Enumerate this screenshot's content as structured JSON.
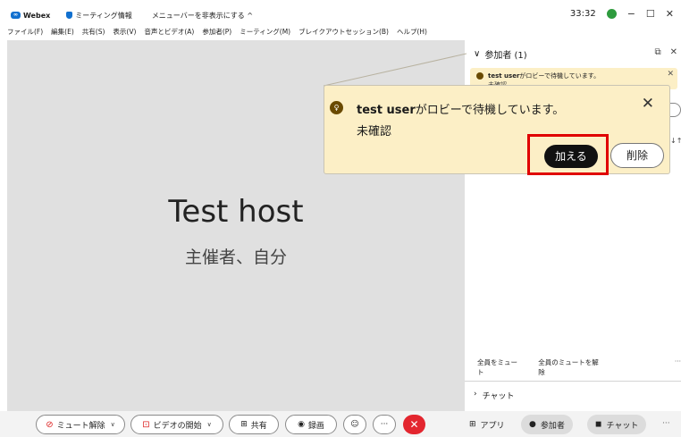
{
  "titlebar": {
    "app_name": "Webex",
    "meeting_info": "ミーティング情報",
    "hide_menu": "メニューバーを非表示にする",
    "hide_menu_chevron": "^",
    "timer": "33:32",
    "minimize": "−",
    "restore": "☐",
    "close": "✕"
  },
  "menubar": {
    "items": [
      "ファイル(F)",
      "編集(E)",
      "共有(S)",
      "表示(V)",
      "音声とビデオ(A)",
      "参加者(P)",
      "ミーティング(M)",
      "ブレイクアウトセッション(B)",
      "ヘルプ(H)"
    ]
  },
  "stage": {
    "host_name": "Test host",
    "host_role": "主催者、自分"
  },
  "panel": {
    "title": "参加者 (1)",
    "mini_notification": {
      "user": "test user",
      "message": "がロビーで待機しています。",
      "status": "未確認"
    },
    "mute_all": "全員をミュート",
    "unmute_all": "全員のミュートを解除",
    "more": "···",
    "chat": "チャット"
  },
  "popup": {
    "user": "test user",
    "message": "がロビーで待機しています。",
    "status": "未確認",
    "admit": "加える",
    "remove": "削除",
    "close": "✕"
  },
  "toolbar": {
    "unmute": "ミュート解除",
    "start_video": "ビデオの開始",
    "share": "共有",
    "record": "録画",
    "more": "···",
    "end": "✕",
    "apps": "アプリ",
    "participants": "参加者",
    "chat": "チャット",
    "overflow": "···"
  },
  "colors": {
    "stage_bg": "#e0e0e0",
    "notification_bg": "#fcefc6",
    "highlight": "#e00000",
    "end_call": "#e3262f",
    "webex_blue": "#1170cf"
  }
}
